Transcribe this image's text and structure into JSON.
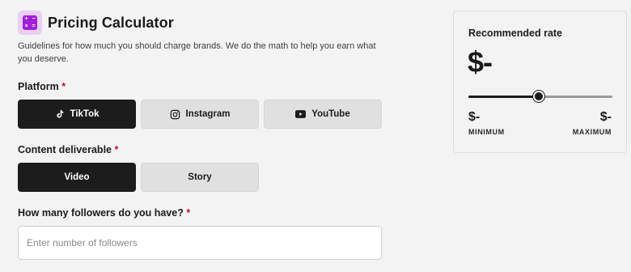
{
  "header": {
    "title": "Pricing Calculator",
    "subtitle": "Guidelines for how much you should charge brands. We do the math to help you earn what you deserve.",
    "logo_icon": "calculator-icon",
    "logo_color": "#a020d8"
  },
  "platform": {
    "label": "Platform",
    "required_mark": "*",
    "options": [
      {
        "label": "TikTok",
        "icon": "tiktok-icon",
        "selected": true
      },
      {
        "label": "Instagram",
        "icon": "instagram-icon",
        "selected": false
      },
      {
        "label": "YouTube",
        "icon": "youtube-icon",
        "selected": false
      }
    ]
  },
  "deliverable": {
    "label": "Content deliverable",
    "required_mark": "*",
    "options": [
      {
        "label": "Video",
        "selected": true
      },
      {
        "label": "Story",
        "selected": false
      }
    ]
  },
  "followers": {
    "label": "How many followers do you have?",
    "required_mark": "*",
    "placeholder": "Enter number of followers",
    "value": ""
  },
  "rate_panel": {
    "title": "Recommended rate",
    "rate": "$-",
    "slider_fraction": 0.49,
    "min_value": "$-",
    "min_label": "MINIMUM",
    "max_value": "$-",
    "max_label": "MAXIMUM"
  },
  "colors": {
    "required": "#c8102e",
    "active_button": "#1c1c1c",
    "inactive_button": "#e0e0e0"
  }
}
